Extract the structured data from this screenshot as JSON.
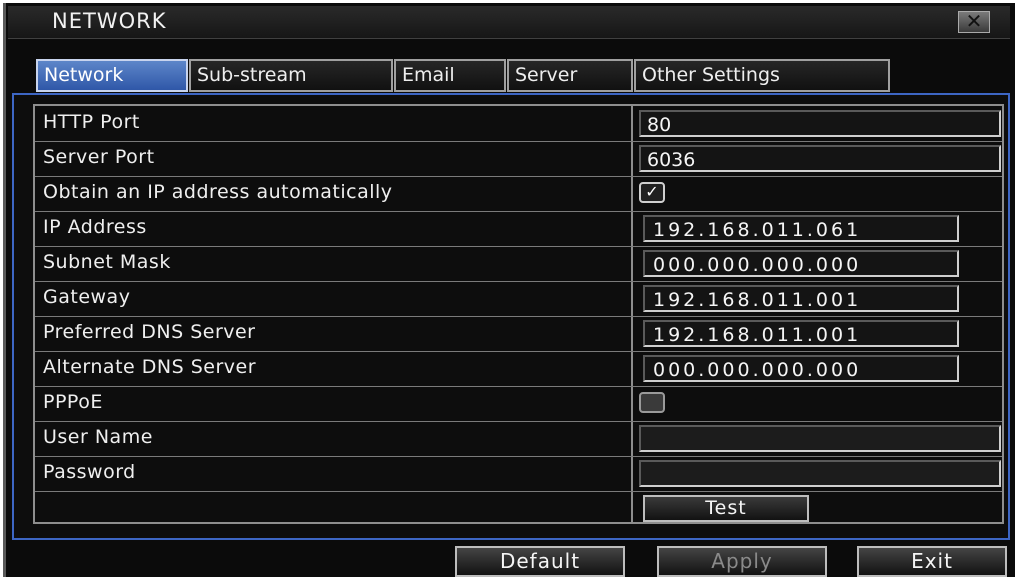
{
  "window": {
    "title": "NETWORK",
    "close_icon": "close-icon"
  },
  "tabs": [
    {
      "label": "Network",
      "active": true
    },
    {
      "label": "Sub-stream",
      "active": false
    },
    {
      "label": "Email",
      "active": false
    },
    {
      "label": "Server",
      "active": false
    },
    {
      "label": "Other Settings",
      "active": false
    }
  ],
  "settings": {
    "http_port": {
      "label": "HTTP Port",
      "value": "80"
    },
    "server_port": {
      "label": "Server Port",
      "value": "6036"
    },
    "obtain_ip": {
      "label": "Obtain an IP address automatically",
      "checked": true
    },
    "ip_address": {
      "label": "IP Address",
      "value": "192.168.011.061"
    },
    "subnet_mask": {
      "label": "Subnet Mask",
      "value": "000.000.000.000"
    },
    "gateway": {
      "label": "Gateway",
      "value": "192.168.011.001"
    },
    "preferred_dns": {
      "label": "Preferred DNS Server",
      "value": "192.168.011.001"
    },
    "alternate_dns": {
      "label": "Alternate DNS Server",
      "value": "000.000.000.000"
    },
    "pppoe": {
      "label": "PPPoE",
      "checked": false
    },
    "user_name": {
      "label": "User Name",
      "value": ""
    },
    "password": {
      "label": "Password",
      "value": ""
    },
    "test_label": "Test"
  },
  "buttons": {
    "default": "Default",
    "apply": "Apply",
    "exit": "Exit"
  },
  "colors": {
    "tab_active": "#3d66c4",
    "panel_border": "#3d66c4",
    "background": "#0b0b0b"
  }
}
